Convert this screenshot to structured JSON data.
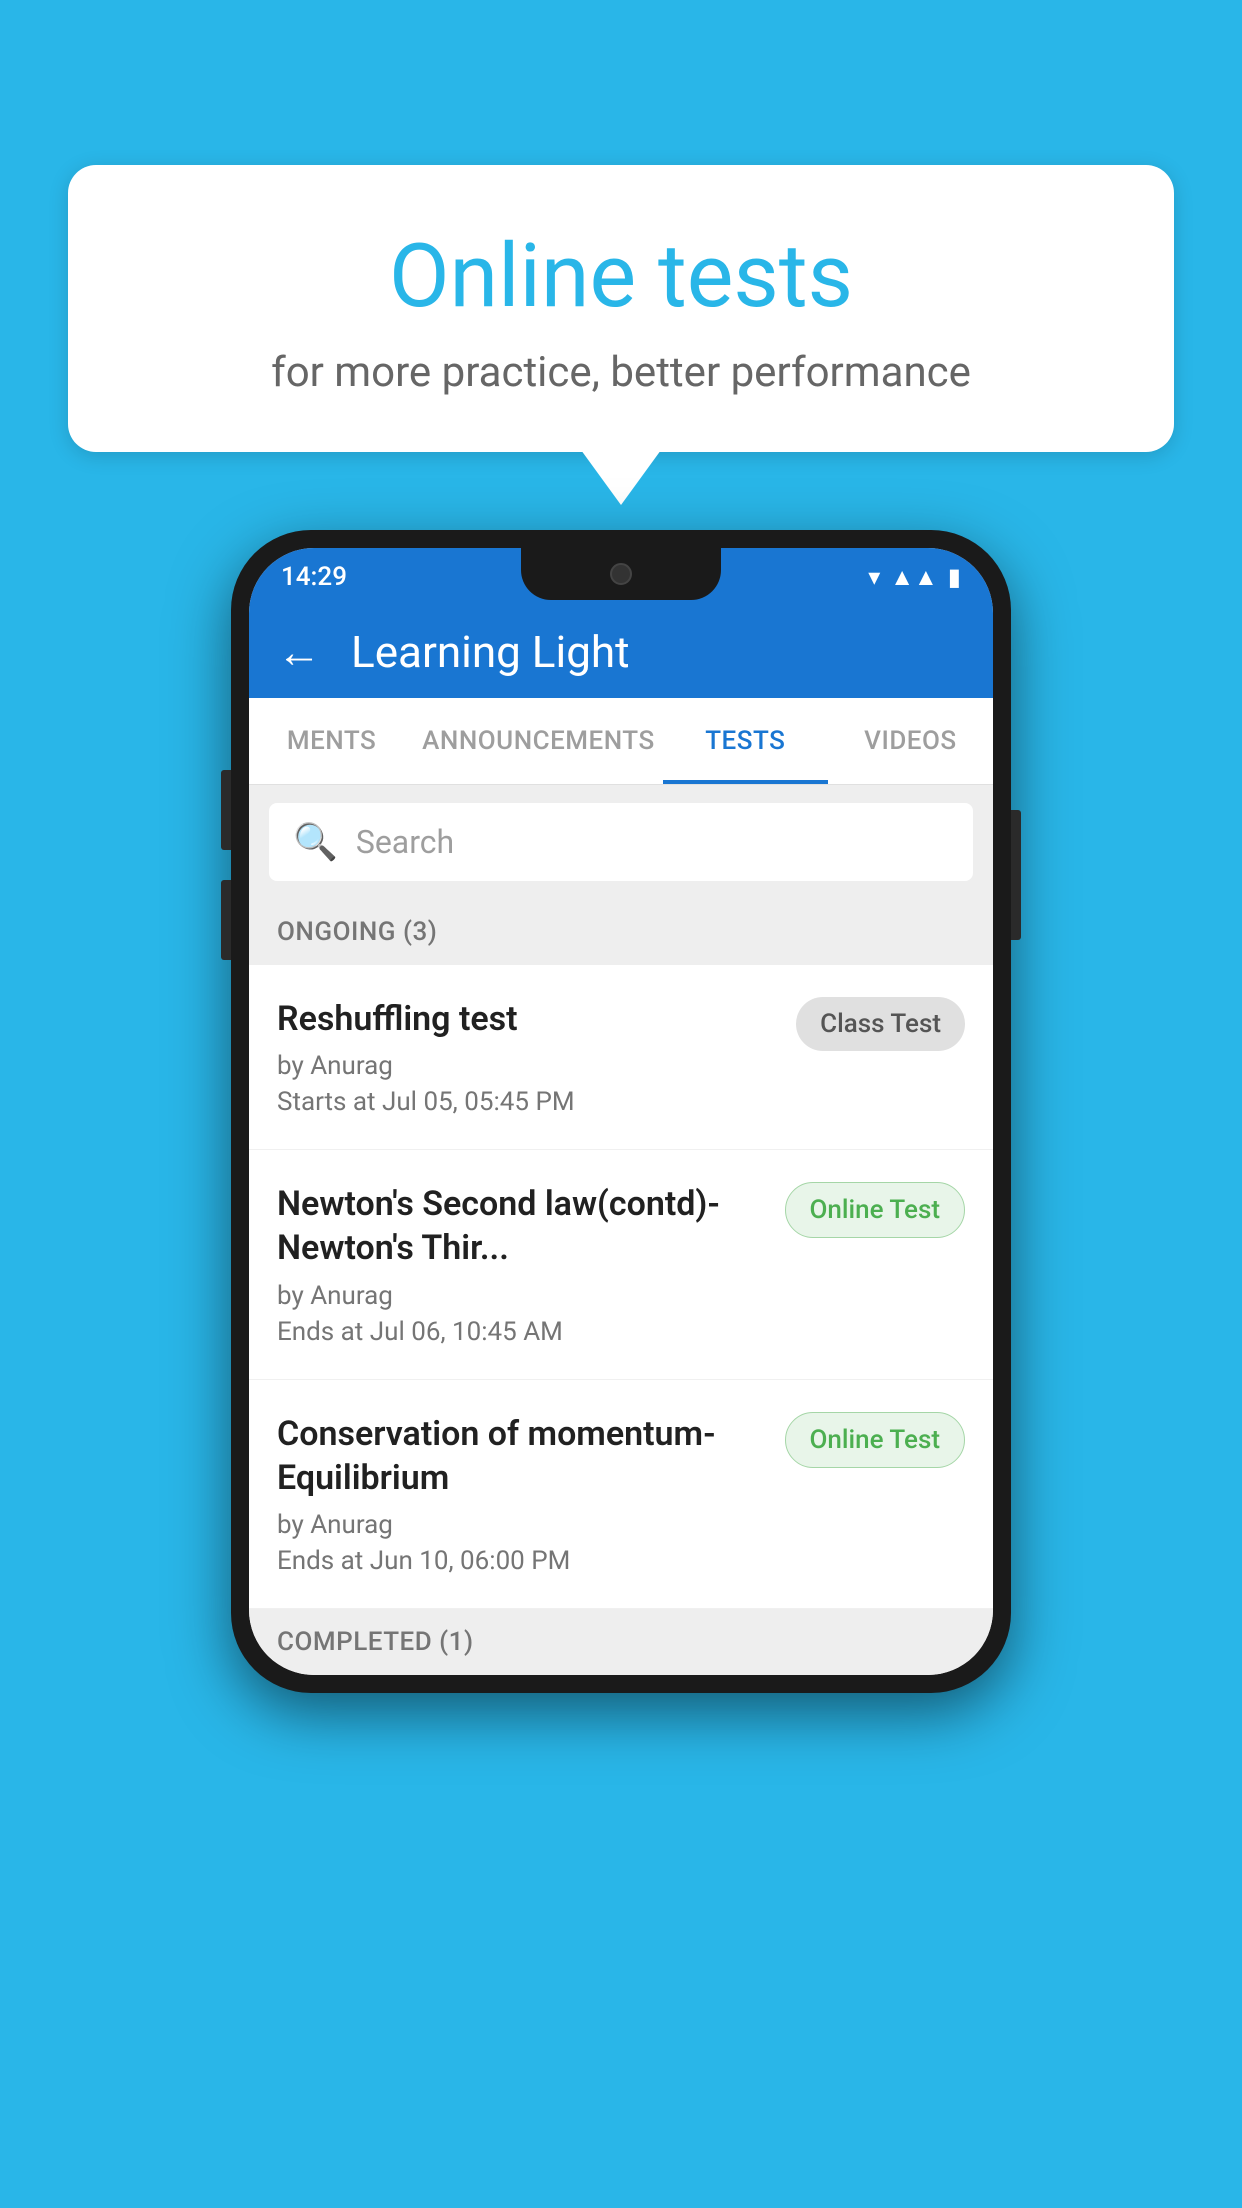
{
  "background_color": "#29b6e8",
  "bubble": {
    "title": "Online tests",
    "subtitle": "for more practice, better performance"
  },
  "status_bar": {
    "time": "14:29",
    "icons": [
      "wifi",
      "signal",
      "battery"
    ]
  },
  "app_bar": {
    "title": "Learning Light",
    "back_label": "←"
  },
  "tabs": [
    {
      "label": "MENTS",
      "active": false
    },
    {
      "label": "ANNOUNCEMENTS",
      "active": false
    },
    {
      "label": "TESTS",
      "active": true
    },
    {
      "label": "VIDEOS",
      "active": false
    }
  ],
  "search": {
    "placeholder": "Search",
    "icon": "🔍"
  },
  "ongoing_section": {
    "label": "ONGOING (3)"
  },
  "tests": [
    {
      "name": "Reshuffling test",
      "author": "by Anurag",
      "date": "Starts at  Jul 05, 05:45 PM",
      "badge": "Class Test",
      "badge_type": "class"
    },
    {
      "name": "Newton's Second law(contd)-Newton's Thir...",
      "author": "by Anurag",
      "date": "Ends at  Jul 06, 10:45 AM",
      "badge": "Online Test",
      "badge_type": "online"
    },
    {
      "name": "Conservation of momentum-Equilibrium",
      "author": "by Anurag",
      "date": "Ends at  Jun 10, 06:00 PM",
      "badge": "Online Test",
      "badge_type": "online"
    }
  ],
  "completed_section": {
    "label": "COMPLETED (1)"
  }
}
